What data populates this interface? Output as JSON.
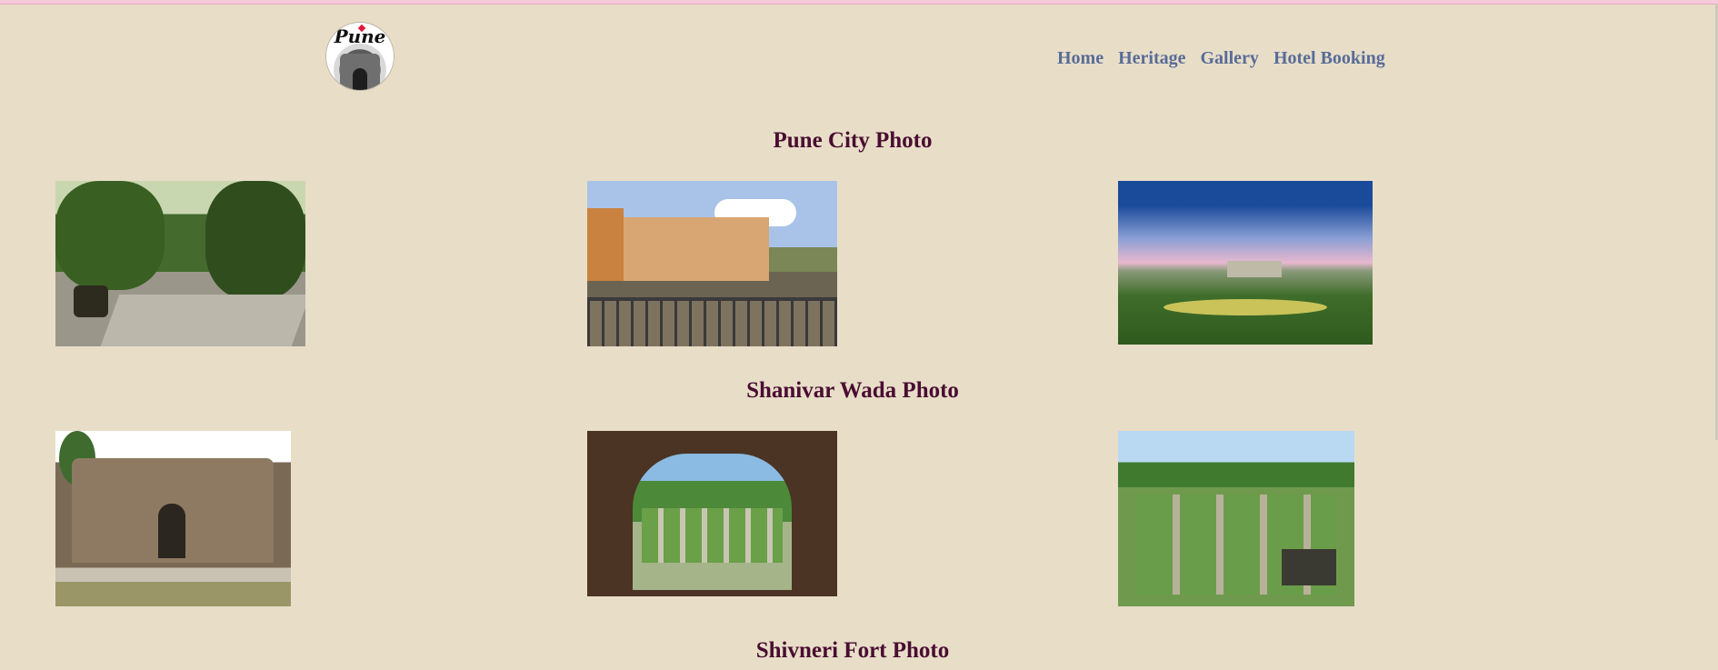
{
  "header": {
    "logo_text": "Pune",
    "nav": [
      {
        "label": "Home"
      },
      {
        "label": "Heritage"
      },
      {
        "label": "Gallery"
      },
      {
        "label": "Hotel Booking"
      }
    ]
  },
  "sections": [
    {
      "title": "Pune City Photo"
    },
    {
      "title": "Shanivar Wada Photo"
    },
    {
      "title": "Shivneri Fort Photo"
    }
  ]
}
